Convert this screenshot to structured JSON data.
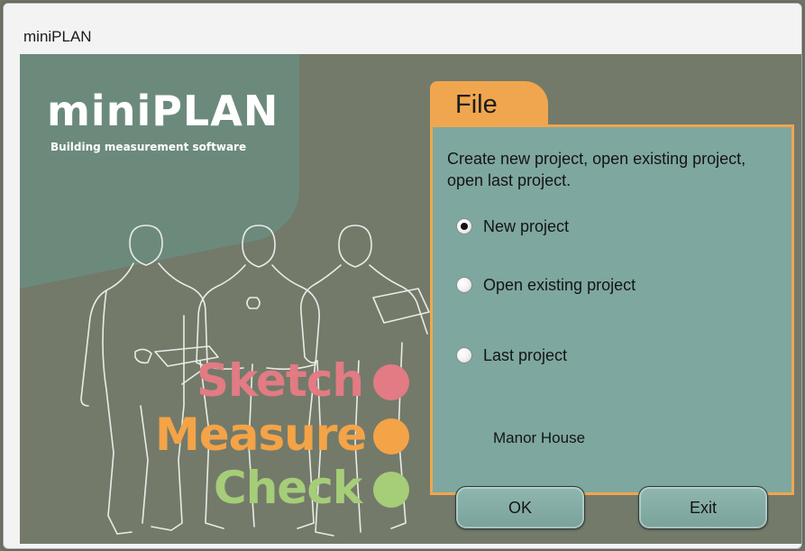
{
  "window": {
    "title": "miniPLAN"
  },
  "logo": {
    "name": "miniPLAN",
    "tagline": "Building measurement software"
  },
  "slogan": [
    {
      "word": "Sketch",
      "color": "#e27b83"
    },
    {
      "word": "Measure",
      "color": "#f4a347"
    },
    {
      "word": "Check",
      "color": "#a6cd78"
    }
  ],
  "file_panel": {
    "tab_label": "File",
    "description": "Create new project, open existing project, open last project.",
    "options": [
      {
        "label": "New project",
        "selected": true
      },
      {
        "label": "Open existing project",
        "selected": false
      },
      {
        "label": "Last project",
        "selected": false
      }
    ],
    "last_project_name": "Manor House",
    "ok_label": "OK",
    "exit_label": "Exit"
  },
  "colors": {
    "background": "#737a6a",
    "logo_panel": "#6c8a7c",
    "panel": "#7ea7a0",
    "accent": "#f0a64e"
  }
}
